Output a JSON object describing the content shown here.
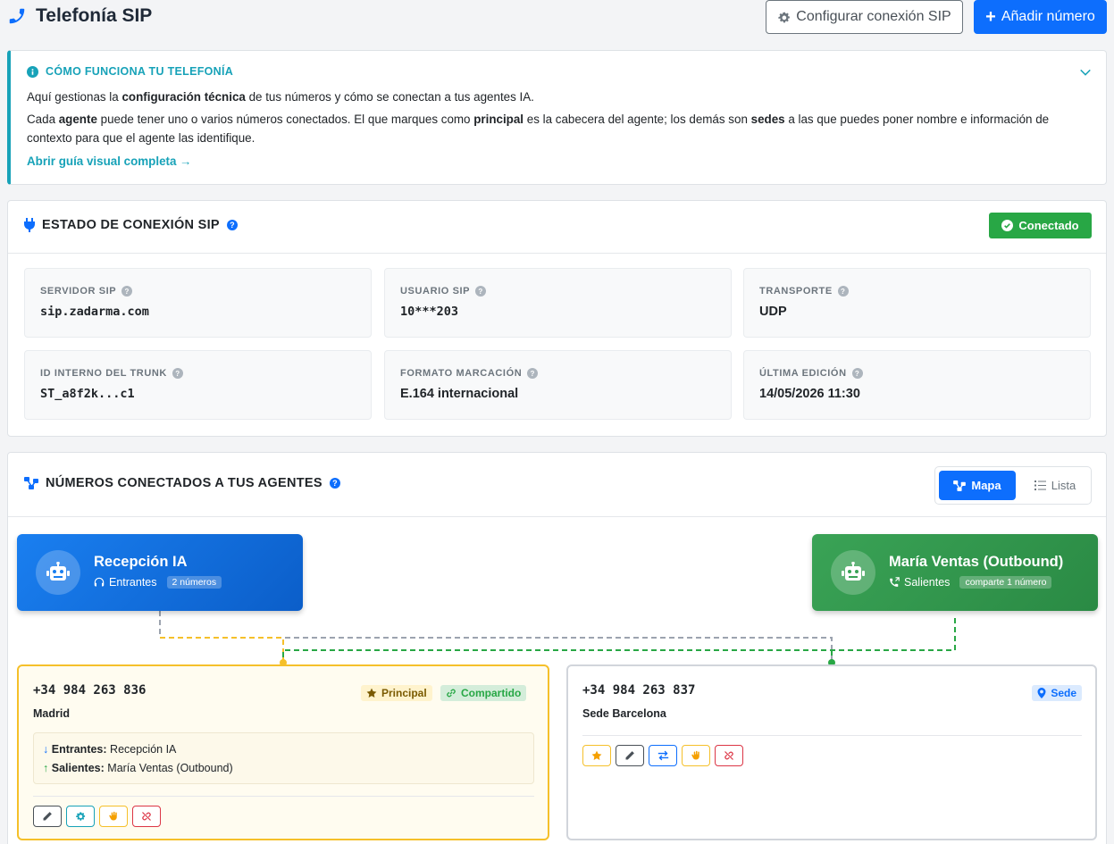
{
  "header": {
    "title": "Telefonía SIP",
    "configure_label": "Configurar conexión SIP",
    "add_label": "Añadir número"
  },
  "info": {
    "heading": "CÓMO FUNCIONA TU TELEFONÍA",
    "p1_pre": "Aquí gestionas la ",
    "p1_bold": "configuración técnica",
    "p1_post": " de tus números y cómo se conectan a tus agentes IA.",
    "p2_a": "Cada ",
    "p2_b": "agente",
    "p2_c": " puede tener uno o varios números conectados. El que marques como ",
    "p2_d": "principal",
    "p2_e": " es la cabecera del agente; los demás son ",
    "p2_f": "sedes",
    "p2_g": " a las que puedes poner nombre e información de contexto para que el agente las identifique.",
    "link": "Abrir guía visual completa →"
  },
  "status": {
    "heading": "ESTADO DE CONEXIÓN SIP",
    "badge": "Conectado",
    "fields": [
      {
        "label": "SERVIDOR SIP",
        "value": "sip.zadarma.com"
      },
      {
        "label": "USUARIO SIP",
        "value": "10***203"
      },
      {
        "label": "TRANSPORTE",
        "value": "UDP"
      },
      {
        "label": "ID INTERNO DEL TRUNK",
        "value": "ST_a8f2k...c1"
      },
      {
        "label": "FORMATO MARCACIÓN",
        "value": "E.164 internacional"
      },
      {
        "label": "ÚLTIMA EDICIÓN",
        "value": "14/05/2026 11:30"
      }
    ]
  },
  "numbers": {
    "heading": "NÚMEROS CONECTADOS A TUS AGENTES",
    "view_map": "Mapa",
    "view_list": "Lista",
    "agents": [
      {
        "name": "Recepción IA",
        "direction": "Entrantes",
        "count": "2 números"
      },
      {
        "name": "María Ventas (Outbound)",
        "direction": "Salientes",
        "count": "comparte 1 número"
      }
    ],
    "cards": [
      {
        "phone": "+34 984 263 836",
        "location": "Madrid",
        "chip_principal": "Principal",
        "chip_shared": "Compartido",
        "in_label": "Entrantes:",
        "in_value": "Recepción IA",
        "out_label": "Salientes:",
        "out_value": "María Ventas (Outbound)"
      },
      {
        "phone": "+34 984 263 837",
        "location": "Sede Barcelona",
        "chip_sede": "Sede"
      }
    ]
  },
  "colors": {
    "primary": "#0d6efd",
    "info": "#17a2b8",
    "success": "#28a745",
    "warning": "#f5c02a",
    "danger": "#dc3545"
  }
}
